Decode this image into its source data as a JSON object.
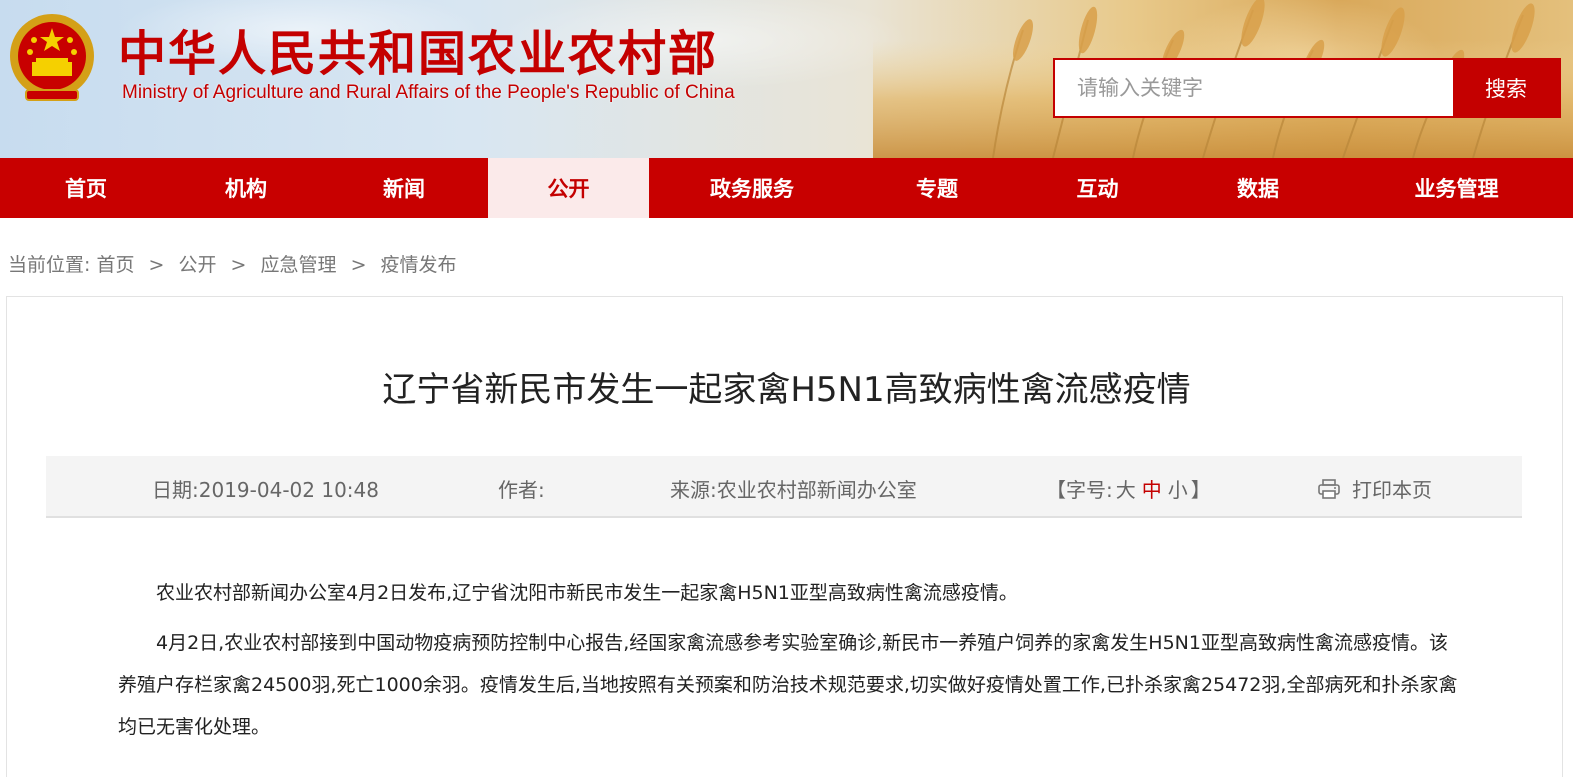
{
  "header": {
    "title_cn": "中华人民共和国农业农村部",
    "title_en": "Ministry of Agriculture and Rural Affairs of the People's Republic of China"
  },
  "search": {
    "placeholder": "请输入关键字",
    "value": "",
    "button_label": "搜索"
  },
  "nav": {
    "items": [
      {
        "label": "首页"
      },
      {
        "label": "机构"
      },
      {
        "label": "新闻"
      },
      {
        "label": "公开"
      },
      {
        "label": "政务服务"
      },
      {
        "label": "专题"
      },
      {
        "label": "互动"
      },
      {
        "label": "数据"
      },
      {
        "label": "业务管理"
      }
    ],
    "active": "公开"
  },
  "breadcrumb": {
    "prefix": "当前位置:",
    "items": [
      "首页",
      "公开",
      "应急管理",
      "疫情发布"
    ],
    "separator": ">"
  },
  "article": {
    "title": "辽宁省新民市发生一起家禽H5N1高致病性禽流感疫情",
    "meta": {
      "date_label": "日期:",
      "date": "2019-04-02 10:48",
      "author_label": "作者:",
      "author": "",
      "source_label": "来源:",
      "source": "农业农村部新闻办公室",
      "font_open": "【字号:",
      "font_large": "大",
      "font_medium": "中",
      "font_small": "小",
      "font_close": "】",
      "print_label": "打印本页"
    },
    "paragraphs": [
      "农业农村部新闻办公室4月2日发布,辽宁省沈阳市新民市发生一起家禽H5N1亚型高致病性禽流感疫情。",
      "4月2日,农业农村部接到中国动物疫病预防控制中心报告,经国家禽流感参考实验室确诊,新民市一养殖户饲养的家禽发生H5N1亚型高致病性禽流感疫情。该养殖户存栏家禽24500羽,死亡1000余羽。疫情发生后,当地按照有关预案和防治技术规范要求,切实做好疫情处置工作,已扑杀家禽25472羽,全部病死和扑杀家禽均已无害化处理。"
    ]
  },
  "colors": {
    "brand_red": "#c40000",
    "nav_bg": "#c80000",
    "nav_active_bg": "#fbeaea",
    "meta_bg": "#f4f4f4"
  },
  "icons": {
    "emblem": "national-emblem-icon",
    "print": "printer-icon"
  }
}
